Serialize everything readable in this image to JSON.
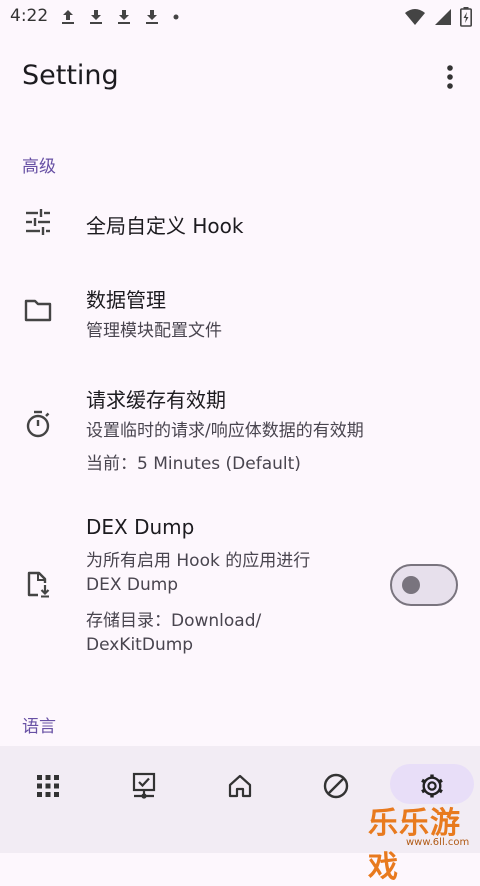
{
  "status_bar": {
    "time": "4:22"
  },
  "app_bar": {
    "title": "Setting"
  },
  "sections": {
    "advanced": {
      "header": "高级"
    },
    "language": {
      "header": "语言"
    }
  },
  "prefs": {
    "global_hook": {
      "title": "全局自定义 Hook",
      "icon": "tune-icon"
    },
    "data_mgmt": {
      "title": "数据管理",
      "subtitle": "管理模块配置文件",
      "icon": "folder-icon"
    },
    "cache": {
      "title": "请求缓存有效期",
      "subtitle": "设置临时的请求/响应体数据的有效期",
      "current": "当前：5 Minutes (Default)",
      "icon": "timer-icon"
    },
    "dex_dump": {
      "title": "DEX Dump",
      "line1": "为所有启用 Hook 的应用进行",
      "line2": "DEX Dump",
      "line3": "存储目录：Download/",
      "line4": "DexKitDump",
      "enabled": false,
      "icon": "file-download-icon"
    }
  },
  "nav": {
    "items": [
      {
        "icon": "apps-icon"
      },
      {
        "icon": "device-check-icon"
      },
      {
        "icon": "home-icon"
      },
      {
        "icon": "block-icon"
      },
      {
        "icon": "settings-icon",
        "selected": true
      }
    ]
  },
  "watermark": {
    "text": "乐乐游戏",
    "url": "www.6ll.com"
  },
  "colors": {
    "accent": "#6750a4",
    "background": "#fdf7fd",
    "nav_background": "#f2ecf4",
    "selected_pill": "#e8def8"
  }
}
